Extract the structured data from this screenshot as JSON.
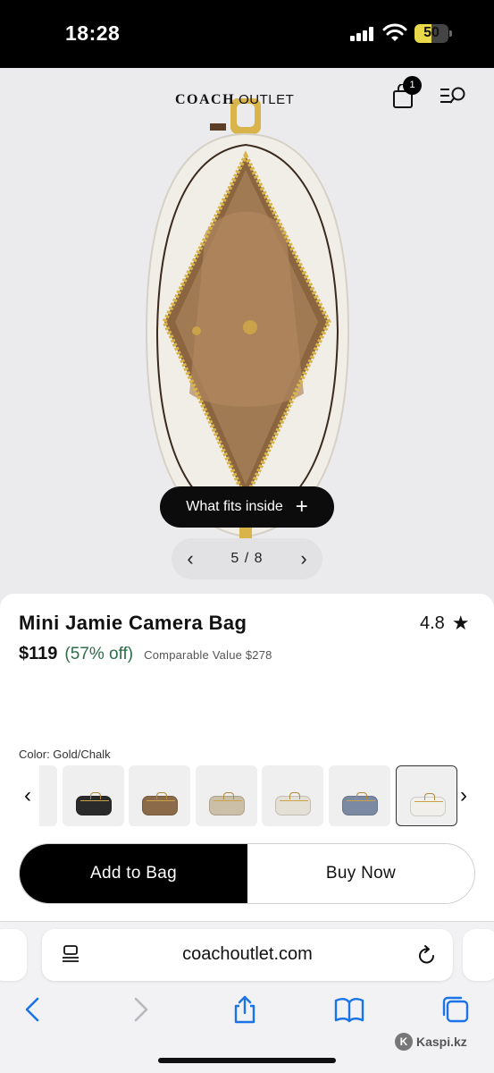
{
  "status_bar": {
    "time": "18:28",
    "battery": "50",
    "battery_level": 0.5
  },
  "header": {
    "brand_main": "COACH",
    "brand_sub": "OUTLET",
    "cart_count": "1",
    "icons": [
      "shopping-bag-icon",
      "menu-search-icon"
    ]
  },
  "gallery": {
    "fits_button_label": "What fits inside",
    "fits_button_icon": "+",
    "prev_icon": "‹",
    "next_icon": "›",
    "current": "5",
    "separator": "/",
    "total": "8"
  },
  "product": {
    "title": "Mini Jamie Camera Bag",
    "rating": "4.8",
    "rating_icon": "★",
    "price": "$119",
    "discount": "(57% off)",
    "comparable_label": "Comparable Value",
    "comparable_value": "$278",
    "color_label": "Color: Gold/Chalk",
    "swatch_prev_icon": "‹",
    "swatch_next_icon": "›",
    "swatches": [
      {
        "name": "swatch-black",
        "color": "#2a2a2a"
      },
      {
        "name": "swatch-brown-signature",
        "color": "#8a6a48"
      },
      {
        "name": "swatch-khaki-signature",
        "color": "#cbbfa8"
      },
      {
        "name": "swatch-chalk-signature",
        "color": "#e4e0d6"
      },
      {
        "name": "swatch-denim",
        "color": "#7b8aa2"
      },
      {
        "name": "swatch-gold-chalk",
        "color": "#f1efe9"
      }
    ],
    "add_to_bag": "Add to Bag",
    "buy_now": "Buy Now"
  },
  "browser": {
    "url": "coachoutlet.com"
  },
  "watermark": {
    "text": "Kaspi.kz"
  }
}
